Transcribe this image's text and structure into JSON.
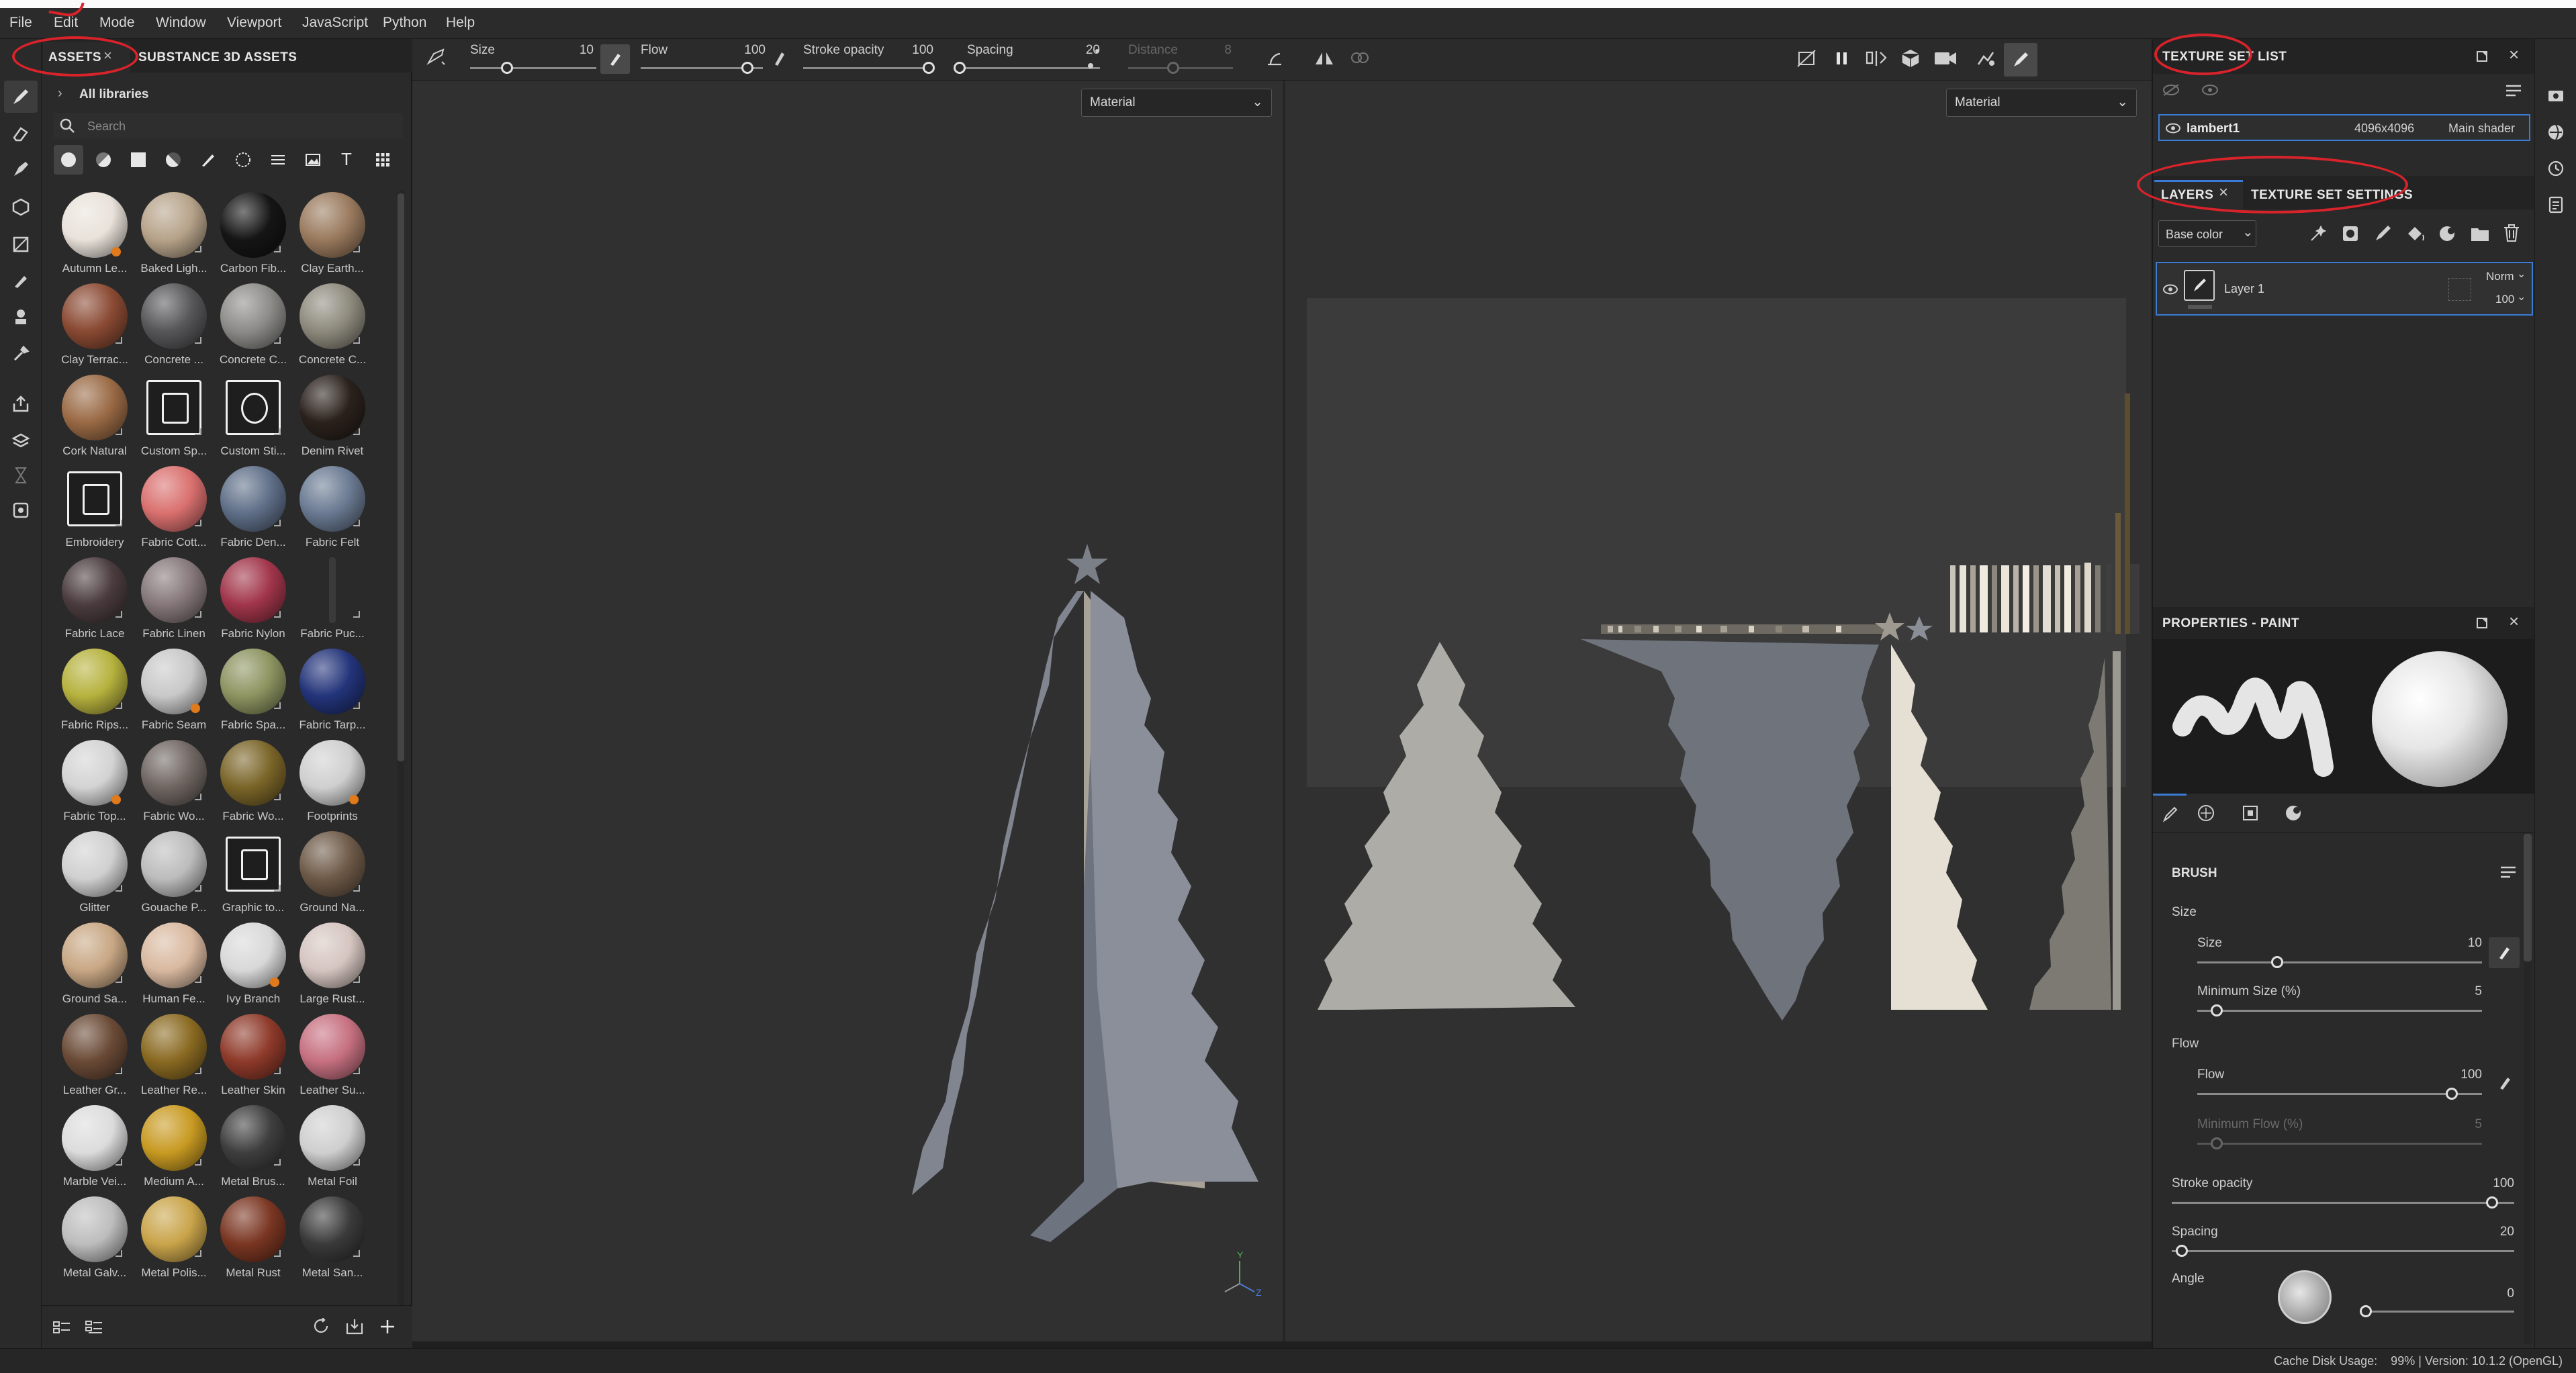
{
  "menu": [
    "File",
    "Edit",
    "Mode",
    "Window",
    "Viewport",
    "JavaScript",
    "Python",
    "Help"
  ],
  "assets_panel": {
    "tabs": [
      "ASSETS",
      "SUBSTANCE 3D ASSETS"
    ],
    "breadcrumb": "All libraries",
    "search_placeholder": "Search",
    "items": [
      {
        "label": "Autumn Le...",
        "color": "#e9e2da",
        "accent": "#b04a22",
        "badge": true
      },
      {
        "label": "Baked Ligh...",
        "color": "#b7a38a"
      },
      {
        "label": "Carbon Fib...",
        "color": "#151515"
      },
      {
        "label": "Clay Earth...",
        "color": "#9a7a5e"
      },
      {
        "label": "Clay Terrac...",
        "color": "#8a4a33"
      },
      {
        "label": "Concrete ...",
        "color": "#57575a"
      },
      {
        "label": "Concrete C...",
        "color": "#8c8b88"
      },
      {
        "label": "Concrete C...",
        "color": "#8e8a7d"
      },
      {
        "label": "Cork Natural",
        "color": "#9a6a45"
      },
      {
        "label": "Custom Sp...",
        "color": "#f0f0f0",
        "kind": "icon-spray"
      },
      {
        "label": "Custom Sti...",
        "color": "#f0f0f0",
        "kind": "icon-sticker"
      },
      {
        "label": "Denim Rivet",
        "color": "#2a211c"
      },
      {
        "label": "Embroidery",
        "color": "#f0f0f0",
        "kind": "icon-embroidery"
      },
      {
        "label": "Fabric Cott...",
        "color": "#d9706e"
      },
      {
        "label": "Fabric Den...",
        "color": "#5f6f88"
      },
      {
        "label": "Fabric Felt",
        "color": "#6a7a92"
      },
      {
        "label": "Fabric Lace",
        "color": "#4b3c3e"
      },
      {
        "label": "Fabric Linen",
        "color": "#85777a"
      },
      {
        "label": "Fabric Nylon",
        "color": "#a1354a"
      },
      {
        "label": "Fabric Puc...",
        "color": "#3a3a3a",
        "kind": "thin"
      },
      {
        "label": "Fabric Rips...",
        "color": "#b6b23e"
      },
      {
        "label": "Fabric Seam",
        "color": "#c8c8c8",
        "badge": true
      },
      {
        "label": "Fabric Spa...",
        "color": "#8d9460"
      },
      {
        "label": "Fabric Tarp...",
        "color": "#23347a"
      },
      {
        "label": "Fabric Top...",
        "color": "#d3d3d3",
        "badge": true
      },
      {
        "label": "Fabric Wo...",
        "color": "#6f6662"
      },
      {
        "label": "Fabric Wo...",
        "color": "#7a6528"
      },
      {
        "label": "Footprints",
        "color": "#cfcfcf",
        "badge": true
      },
      {
        "label": "Glitter",
        "color": "#d0d0d0"
      },
      {
        "label": "Gouache P...",
        "color": "#bcbcbc"
      },
      {
        "label": "Graphic to...",
        "color": "#f0f0f0",
        "kind": "icon-graphic"
      },
      {
        "label": "Ground Na...",
        "color": "#6e5a48"
      },
      {
        "label": "Ground Sa...",
        "color": "#c8a784"
      },
      {
        "label": "Human Fe...",
        "color": "#d9b9a0"
      },
      {
        "label": "Ivy Branch",
        "color": "#d8d8d8",
        "badge": true
      },
      {
        "label": "Large Rust...",
        "color": "#d5c5c0"
      },
      {
        "label": "Leather Gr...",
        "color": "#6a4a36"
      },
      {
        "label": "Leather Re...",
        "color": "#8a6a22"
      },
      {
        "label": "Leather Skin",
        "color": "#8e3a2a"
      },
      {
        "label": "Leather Su...",
        "color": "#c67080"
      },
      {
        "label": "Marble Vei...",
        "color": "#dcdcdc"
      },
      {
        "label": "Medium A...",
        "color": "#c89a22"
      },
      {
        "label": "Metal Brus...",
        "color": "#3e3e3e"
      },
      {
        "label": "Metal Foil",
        "color": "#cfcfcf"
      },
      {
        "label": "Metal Galv...",
        "color": "#bdbdbd"
      },
      {
        "label": "Metal Polis...",
        "color": "#c9a44a"
      },
      {
        "label": "Metal Rust",
        "color": "#7a3622"
      },
      {
        "label": "Metal San...",
        "color": "#3a3a3a"
      }
    ]
  },
  "context_bar": {
    "size_label": "Size",
    "size_value": "10",
    "flow_label": "Flow",
    "flow_value": "100",
    "opacity_label": "Stroke opacity",
    "opacity_value": "100",
    "spacing_label": "Spacing",
    "spacing_value": "20",
    "distance_label": "Distance",
    "distance_value": "8"
  },
  "viewport": {
    "left_mode": "Material",
    "right_mode": "Material"
  },
  "texture_set_list": {
    "title": "TEXTURE SET LIST",
    "row": {
      "name": "lambert1",
      "resolution": "4096x4096",
      "shader": "Main shader"
    }
  },
  "layers": {
    "tabs": [
      "LAYERS",
      "TEXTURE SET SETTINGS"
    ],
    "channel": "Base color",
    "layer": {
      "name": "Layer 1",
      "blend": "Norm",
      "opacity": "100"
    }
  },
  "properties": {
    "title": "PROPERTIES - PAINT",
    "section": "BRUSH",
    "size_group": "Size",
    "size_label": "Size",
    "size_value": "10",
    "min_size_label": "Minimum Size (%)",
    "min_size_value": "5",
    "flow_group": "Flow",
    "flow_label": "Flow",
    "flow_value": "100",
    "min_flow_label": "Minimum Flow (%)",
    "min_flow_value": "5",
    "opacity_label": "Stroke opacity",
    "opacity_value": "100",
    "spacing_label": "Spacing",
    "spacing_value": "20",
    "angle_label": "Angle",
    "angle_value": "0"
  },
  "status": {
    "text": "Cache Disk Usage:    99% | Version: 10.1.2 (OpenGL)"
  },
  "colors": {
    "annotation": "#d9232b",
    "accent": "#3a7bd5",
    "badge": "#e07a1a"
  }
}
